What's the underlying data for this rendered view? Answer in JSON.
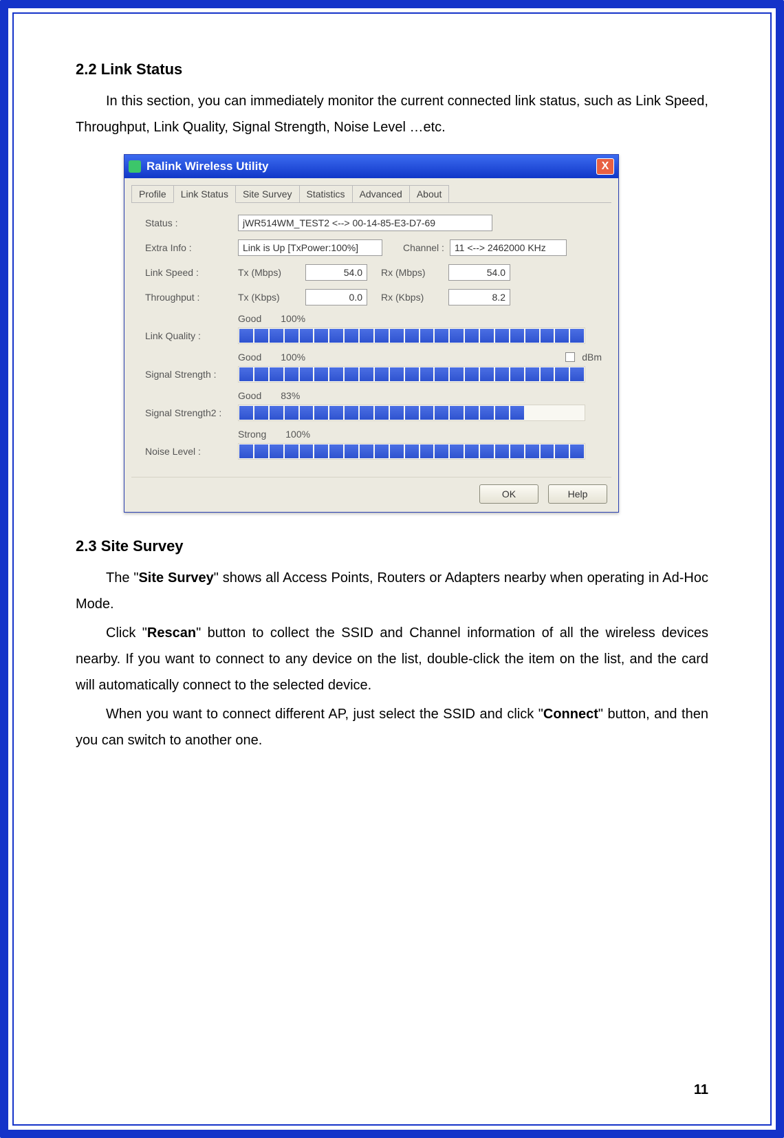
{
  "page_number": "11",
  "section1": {
    "heading": "2.2  Link Status",
    "para1": "In this section, you can immediately monitor the current connected link status, such as Link Speed, Throughput, Link Quality, Signal Strength, Noise Level …etc."
  },
  "section2": {
    "heading": "2.3  Site Survey",
    "para1_pre": "The \"",
    "para1_bold": "Site Survey",
    "para1_post": "\" shows all Access Points, Routers or Adapters nearby when operating in Ad-Hoc Mode.",
    "para2_pre": "Click \"",
    "para2_bold": "Rescan",
    "para2_post": "\" button to collect the SSID and Channel information of all the wireless devices nearby. If you want to connect to any device on the list, double-click the item on the list, and the card will automatically connect to the selected device.",
    "para3_pre": "When you want to connect different AP, just select the SSID and click \"",
    "para3_bold": "Connect",
    "para3_post": "\" button, and then you can switch to another one."
  },
  "window": {
    "title": "Ralink Wireless Utility",
    "close": "X",
    "tabs": {
      "profile": "Profile",
      "link_status": "Link Status",
      "site_survey": "Site Survey",
      "statistics": "Statistics",
      "advanced": "Advanced",
      "about": "About"
    },
    "labels": {
      "status": "Status :",
      "extra_info": "Extra Info :",
      "channel": "Channel :",
      "link_speed": "Link Speed :",
      "throughput": "Throughput :",
      "tx_mbps": "Tx (Mbps)",
      "rx_mbps": "Rx (Mbps)",
      "tx_kbps": "Tx (Kbps)",
      "rx_kbps": "Rx (Kbps)",
      "link_quality": "Link Quality :",
      "signal_strength": "Signal Strength :",
      "signal_strength2": "Signal Strength2 :",
      "noise_level": "Noise Level :",
      "good": "Good",
      "strong": "Strong",
      "dbm": "dBm"
    },
    "values": {
      "status": "jWR514WM_TEST2 <--> 00-14-85-E3-D7-69",
      "extra_info": "Link is Up [TxPower:100%]",
      "channel": "11 <--> 2462000 KHz",
      "tx_mbps": "54.0",
      "rx_mbps": "54.0",
      "tx_kbps": "0.0",
      "rx_kbps": "8.2",
      "link_quality_pct": "100%",
      "signal_strength_pct": "100%",
      "signal_strength2_pct": "83%",
      "noise_level_pct": "100%"
    },
    "buttons": {
      "ok": "OK",
      "help": "Help"
    }
  }
}
